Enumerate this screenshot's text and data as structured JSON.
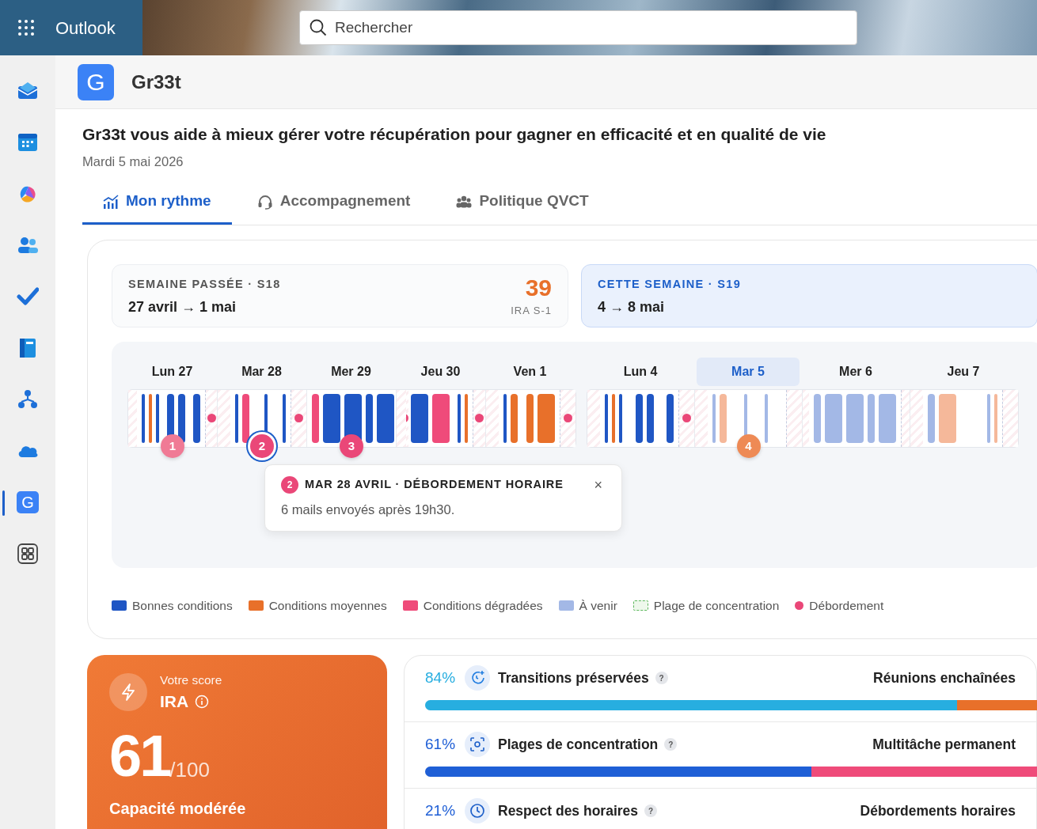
{
  "topbar": {
    "app_name": "Outlook",
    "search": {
      "placeholder": "Rechercher"
    }
  },
  "rail": {
    "items": [
      {
        "kind": "mail",
        "selected": false
      },
      {
        "kind": "calendar",
        "selected": false
      },
      {
        "kind": "swirl",
        "selected": false
      },
      {
        "kind": "people",
        "selected": false
      },
      {
        "kind": "check",
        "selected": false
      },
      {
        "kind": "book",
        "selected": false
      },
      {
        "kind": "hierarchy",
        "selected": false
      },
      {
        "kind": "cloud",
        "selected": false
      },
      {
        "kind": "app",
        "letter": "G",
        "selected": true
      },
      {
        "kind": "apps",
        "selected": false
      }
    ]
  },
  "app_header": {
    "logo_letter": "G",
    "title": "Gr33t"
  },
  "headline": "Gr33t vous aide à mieux gérer votre récupération pour gagner en efficacité et en qualité de vie",
  "date": "Mardi 5 mai 2026",
  "tabs": [
    {
      "label": "Mon rythme",
      "selected": true
    },
    {
      "label": "Accompagnement",
      "selected": false
    },
    {
      "label": "Politique QVCT",
      "selected": false
    }
  ],
  "weeks": [
    {
      "kicker": "SEMAINE PASSÉE · S18",
      "range": "27 avril → 1 mai",
      "score": "39",
      "score_label": "IRA S-1",
      "selected": false
    },
    {
      "kicker": "CETTE SEMAINE · S19",
      "range": "4 → 8 mai",
      "selected": true
    }
  ],
  "timeline": {
    "weeks": [
      {
        "days": [
          {
            "label": "Lun 27",
            "selected": false,
            "overflow": true,
            "marker": {
              "label": "1",
              "color": "#f07a95",
              "selected": false
            },
            "blocks": [
              {
                "kind": "good-s"
              },
              {
                "kind": "medium-s"
              },
              {
                "kind": "good-s"
              },
              {
                "kind": "gap"
              },
              {
                "kind": "good-m"
              },
              {
                "kind": "good-m"
              },
              {
                "kind": "gap"
              },
              {
                "kind": "good-m"
              }
            ]
          },
          {
            "label": "Mar 28",
            "selected": false,
            "overflow": true,
            "marker": {
              "label": "2",
              "color": "#ea4778",
              "selected": true
            },
            "blocks": [
              {
                "kind": "good-s"
              },
              {
                "kind": "degraded-m"
              },
              {
                "kind": "gap"
              },
              {
                "kind": "good-s"
              },
              {
                "kind": "gap"
              },
              {
                "kind": "good-s"
              }
            ]
          },
          {
            "label": "Mer 29",
            "selected": false,
            "overflow": true,
            "marker": {
              "label": "3",
              "color": "#ea4778",
              "selected": false
            },
            "blocks": [
              {
                "kind": "degraded-m"
              },
              {
                "kind": "good-l"
              },
              {
                "kind": "good-l"
              },
              {
                "kind": "good-m"
              },
              {
                "kind": "good-l"
              }
            ]
          },
          {
            "label": "Jeu 30",
            "selected": false,
            "overflow": true,
            "blocks": [
              {
                "kind": "good-l"
              },
              {
                "kind": "degraded-l"
              },
              {
                "kind": "gap"
              },
              {
                "kind": "good-s"
              },
              {
                "kind": "medium-s"
              }
            ]
          },
          {
            "label": "Ven 1",
            "selected": false,
            "overflow": true,
            "blocks": [
              {
                "kind": "good-s"
              },
              {
                "kind": "medium-m"
              },
              {
                "kind": "gap"
              },
              {
                "kind": "medium-m"
              },
              {
                "kind": "medium-l"
              }
            ]
          }
        ]
      },
      {
        "days": [
          {
            "label": "Lun 4",
            "selected": false,
            "overflow": true,
            "blocks": [
              {
                "kind": "good-s"
              },
              {
                "kind": "medium-s"
              },
              {
                "kind": "good-s"
              },
              {
                "kind": "gap"
              },
              {
                "kind": "good-m"
              },
              {
                "kind": "good-m"
              },
              {
                "kind": "gap"
              },
              {
                "kind": "good-m"
              }
            ]
          },
          {
            "label": "Mar 5",
            "selected": true,
            "overflow": false,
            "marker": {
              "label": "4",
              "color": "#ee8a55",
              "selected": false
            },
            "blocks": [
              {
                "kind": "upcoming-s"
              },
              {
                "kind": "upcomingmedium-m"
              },
              {
                "kind": "gap"
              },
              {
                "kind": "upcoming-s"
              },
              {
                "kind": "gap"
              },
              {
                "kind": "upcoming-s"
              },
              {
                "kind": "gap"
              }
            ]
          },
          {
            "label": "Mer 6",
            "selected": false,
            "overflow": false,
            "blocks": [
              {
                "kind": "upcoming-m"
              },
              {
                "kind": "upcoming-l"
              },
              {
                "kind": "upcoming-l"
              },
              {
                "kind": "upcoming-m"
              },
              {
                "kind": "upcoming-l"
              }
            ]
          },
          {
            "label": "Jeu 7",
            "selected": false,
            "overflow": false,
            "blocks": [
              {
                "kind": "upcoming-m"
              },
              {
                "kind": "upcomingmedium-l"
              },
              {
                "kind": "gap"
              },
              {
                "kind": "upcoming-s"
              },
              {
                "kind": "upcomingmedium-s"
              }
            ]
          }
        ]
      }
    ]
  },
  "tooltip": {
    "badge": "2",
    "title": "MAR 28 AVRIL · DÉBORDEMENT HORAIRE",
    "text": "6 mails envoyés après 19h30.",
    "close": "×"
  },
  "legend": [
    {
      "label": "Bonnes conditions",
      "kind": "good"
    },
    {
      "label": "Conditions moyennes",
      "kind": "medium"
    },
    {
      "label": "Conditions dégradées",
      "kind": "degraded"
    },
    {
      "label": "À venir",
      "kind": "upcoming"
    },
    {
      "label": "Plage de concentration",
      "kind": "focus"
    },
    {
      "label": "Débordement",
      "kind": "overflow"
    }
  ],
  "score": {
    "kicker": "Votre score",
    "title": "IRA",
    "value": "61",
    "denominator": "/100",
    "status": "Capacité modérée"
  },
  "metrics": [
    {
      "percent": "84%",
      "label": "Transitions préservées",
      "help": "?",
      "right_label": "Réunions enchaînées",
      "level": 0.84,
      "color": "#27aee0",
      "remainder": {
        "color": "#e8702a"
      }
    },
    {
      "percent": "61%",
      "label": "Plages de concentration",
      "help": "?",
      "right_label": "Multitâche permanent",
      "level": 0.61,
      "color": "#1f5fd6",
      "remainder": {
        "color": "#ef4b7a"
      }
    },
    {
      "percent": "21%",
      "label": "Respect des horaires",
      "help": "?",
      "right_label": "Débordements horaires",
      "color": "#1f5fd6"
    }
  ]
}
